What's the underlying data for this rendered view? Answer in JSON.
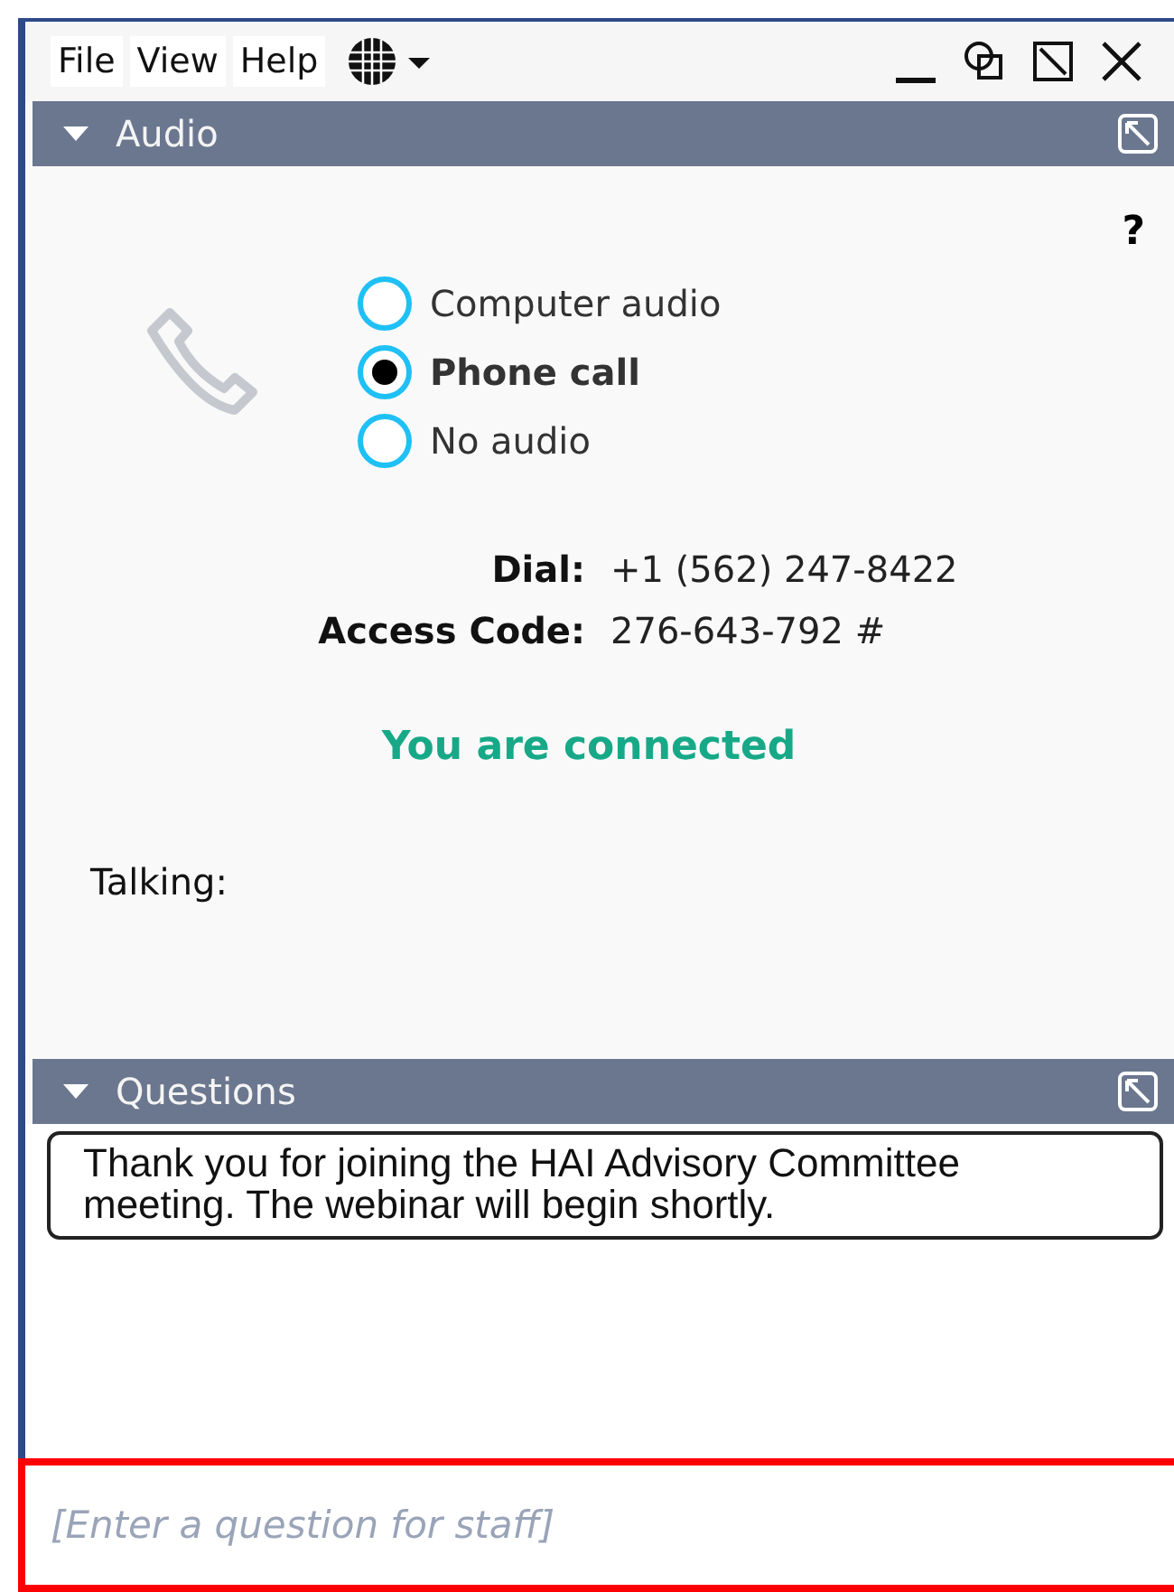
{
  "menu": [
    "File",
    "View",
    "Help"
  ],
  "audio": {
    "title": "Audio",
    "help": "?",
    "options": [
      {
        "label": "Computer audio",
        "selected": false
      },
      {
        "label": "Phone call",
        "selected": true
      },
      {
        "label": "No audio",
        "selected": false
      }
    ],
    "details": [
      {
        "label": "Dial:",
        "value": "+1 (562) 247-8422"
      },
      {
        "label": "Access Code:",
        "value": "276-643-792 #"
      }
    ],
    "status": "You are connected",
    "talking": "Talking:"
  },
  "questions": {
    "title": "Questions",
    "messages": [
      "Thank you for joining the HAI Advisory Committee meeting.  The webinar will begin shortly."
    ],
    "placeholder": "[Enter a question for staff]"
  }
}
